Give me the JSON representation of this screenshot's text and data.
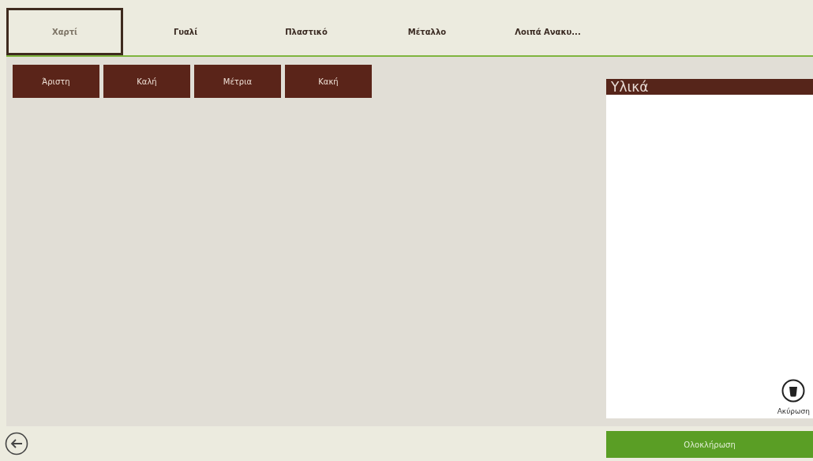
{
  "tabs": [
    {
      "label": "Χαρτί",
      "selected": true
    },
    {
      "label": "Γυαλί",
      "selected": false
    },
    {
      "label": "Πλαστικό",
      "selected": false
    },
    {
      "label": "Μέταλλο",
      "selected": false
    },
    {
      "label": "Λοιπά Ανακυ...",
      "selected": false
    }
  ],
  "quality_buttons": [
    "Άριστη",
    "Καλή",
    "Μέτρια",
    "Κακή"
  ],
  "materials_panel": {
    "title": "Υλικά",
    "cancel_label": "Ακύρωση"
  },
  "complete_button": "Ολοκλήρωση"
}
